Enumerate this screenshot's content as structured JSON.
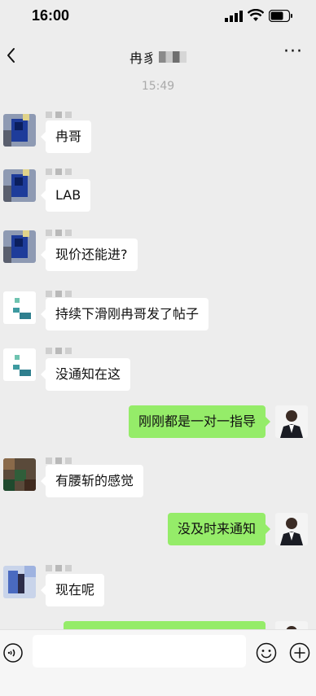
{
  "status": {
    "time": "16:00",
    "signal_icon": "signal-icon",
    "wifi_icon": "wifi-icon",
    "battery_icon": "battery-icon"
  },
  "header": {
    "title": "冉豸",
    "back_icon": "chevron-left-icon",
    "more_label": "···"
  },
  "chat": {
    "timestamp": "15:49",
    "messages": [
      {
        "direction": "in",
        "text": "冉哥"
      },
      {
        "direction": "in",
        "text": "LAB"
      },
      {
        "direction": "in",
        "text": "现价还能进?"
      },
      {
        "direction": "in",
        "text": "持续下滑刚冉哥发了帖子"
      },
      {
        "direction": "in",
        "text": "没通知在这"
      },
      {
        "direction": "out",
        "text": "刚刚都是一对一指导"
      },
      {
        "direction": "in",
        "text": "有腰斩的感觉"
      },
      {
        "direction": "out",
        "text": "没及时来通知"
      },
      {
        "direction": "in",
        "text": "现在呢"
      },
      {
        "direction": "out",
        "text": ""
      }
    ]
  },
  "input_bar": {
    "placeholder": "",
    "value": "",
    "voice_icon": "voice-icon",
    "emoji_icon": "emoji-icon",
    "plus_icon": "plus-icon"
  },
  "colors": {
    "background": "#ededed",
    "outgoing_bubble": "#95ec69",
    "incoming_bubble": "#ffffff"
  }
}
